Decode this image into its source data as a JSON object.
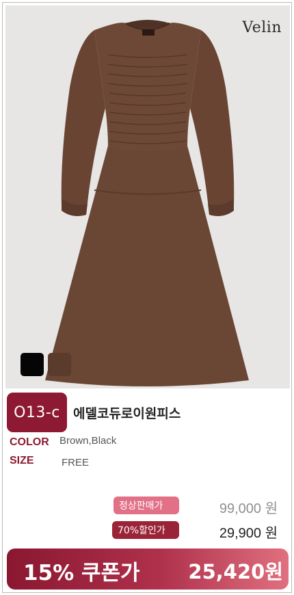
{
  "brand": "Velin",
  "product": {
    "code": "O13-c",
    "name": "에델코듀로이원피스",
    "options": {
      "color_label": "COLOR",
      "color_value": "Brown,Black",
      "size_label": "SIZE",
      "size_value": "FREE"
    },
    "swatches": [
      {
        "name": "black",
        "color": "#050505"
      },
      {
        "name": "brown",
        "color": "#5b3b2c"
      }
    ]
  },
  "pricing": {
    "regular_label": "정상판매가",
    "regular_price": "99,000 원",
    "sale_label": "70%할인가",
    "sale_price": "29,900 원",
    "coupon_label": "15% 쿠폰가",
    "coupon_price": "25,420원"
  },
  "colors": {
    "accent": "#8d1a32",
    "dress": "#6a4634",
    "photo_bg": "#e7e6e5"
  }
}
